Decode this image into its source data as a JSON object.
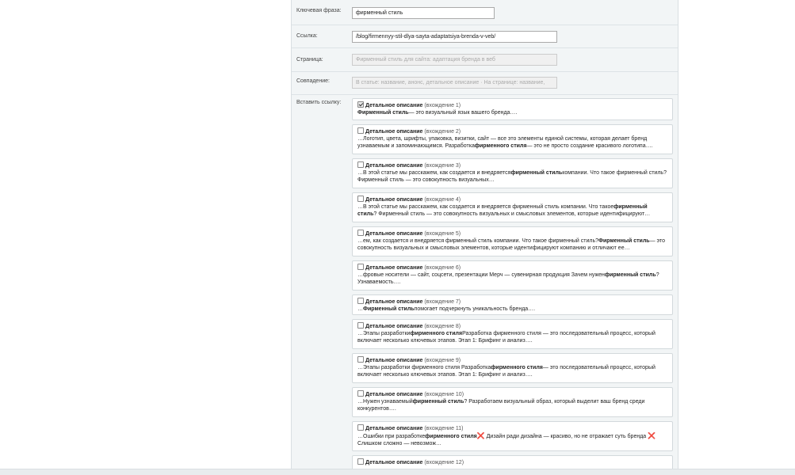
{
  "form": {
    "keyword_label": "Ключевая фраза:",
    "keyword_value": "фирменный стиль",
    "url_label": "Ссылка:",
    "url_value": "/blog/firmennyy-stil-dlya-sayta-adaptatsiya-brenda-v-veb/",
    "page_label": "Страница:",
    "page_value": "Фирменный стиль для сайта: адаптация бренда в веб",
    "match_label": "Совпадение:",
    "match_value": "В статье: название, анонс, детальное описание · На странице: название,",
    "insert_label": "Вставить ссылку:"
  },
  "occurrences": [
    {
      "title": "Детальное описание",
      "num": "(вхождение 1)",
      "checked": true,
      "body": [
        {
          "t": "Фирменный стиль",
          "b": true
        },
        {
          "t": "— это визуальный язык вашего бренда…."
        }
      ]
    },
    {
      "title": "Детальное описание",
      "num": "(вхождение 2)",
      "checked": false,
      "body": [
        {
          "t": "…Логотип, цвета, шрифты, упаковка, визитки, сайт — все это элементы единой системы, которая делает бренд узнаваемым и запоминающимся. Разработка"
        },
        {
          "t": "фирменного стиля",
          "b": true
        },
        {
          "t": "— это не просто создание красивого логотипа…."
        }
      ]
    },
    {
      "title": "Детальное описание",
      "num": "(вхождение 3)",
      "checked": false,
      "body": [
        {
          "t": "…В этой статье мы расскажем, как создается и внедряется"
        },
        {
          "t": "фирменный стиль",
          "b": true
        },
        {
          "t": "компании. Что такое фирменный стиль? Фирменный стиль — это совокупность визуальных…"
        }
      ]
    },
    {
      "title": "Детальное описание",
      "num": "(вхождение 4)",
      "checked": false,
      "body": [
        {
          "t": "…В этой статье мы расскажем, как создается и внедряется фирменный стиль компании. Что такое"
        },
        {
          "t": "фирменный стиль",
          "b": true
        },
        {
          "t": "? Фирменный стиль — это совокупность визуальных и смысловых элементов, которые идентифицируют…"
        }
      ]
    },
    {
      "title": "Детальное описание",
      "num": "(вхождение 5)",
      "checked": false,
      "body": [
        {
          "t": "…ем, как создается и внедряется фирменный стиль компании. Что такое фирменный стиль?"
        },
        {
          "t": "Фирменный стиль",
          "b": true
        },
        {
          "t": "— это совокупность визуальных и смысловых элементов, которые идентифицируют компанию и отличают ее…"
        }
      ]
    },
    {
      "title": "Детальное описание",
      "num": "(вхождение 6)",
      "checked": false,
      "body": [
        {
          "t": "…фровые носители — сайт, соцсети, презентации Мерч — сувенирная продукция Зачем нужен"
        },
        {
          "t": "фирменный стиль",
          "b": true
        },
        {
          "t": "? Узнаваемость…."
        }
      ]
    },
    {
      "title": "Детальное описание",
      "num": "(вхождение 7)",
      "checked": false,
      "body": [
        {
          "t": "…"
        },
        {
          "t": "Фирменный стиль",
          "b": true
        },
        {
          "t": "помогает подчеркнуть уникальность бренда…."
        }
      ]
    },
    {
      "title": "Детальное описание",
      "num": "(вхождение 8)",
      "checked": false,
      "body": [
        {
          "t": "…Этапы разработки"
        },
        {
          "t": "фирменного стиля",
          "b": true
        },
        {
          "t": "Разработка фирменного стиля — это последовательный процесс, который включает несколько ключевых этапов. Этап 1: Брифинг и анализ…."
        }
      ]
    },
    {
      "title": "Детальное описание",
      "num": "(вхождение 9)",
      "checked": false,
      "body": [
        {
          "t": "…Этапы разработки фирменного стиля Разработка"
        },
        {
          "t": "фирменного стиля",
          "b": true
        },
        {
          "t": "— это последовательный процесс, который включает несколько ключевых этапов. Этап 1: Брифинг и анализ…."
        }
      ]
    },
    {
      "title": "Детальное описание",
      "num": "(вхождение 10)",
      "checked": false,
      "body": [
        {
          "t": "…Нужен узнаваемый"
        },
        {
          "t": "фирменный стиль",
          "b": true
        },
        {
          "t": "? Разработаем визуальный образ, который выделит ваш бренд среди конкурентов…."
        }
      ]
    },
    {
      "title": "Детальное описание",
      "num": "(вхождение 11)",
      "checked": false,
      "body": [
        {
          "t": "…Ошибки при разработке"
        },
        {
          "t": "фирменного стиля",
          "b": true
        },
        {
          "t": "❌",
          "x": true
        },
        {
          "t": " Дизайн ради дизайна — красиво, но не отражает суть бренда "
        },
        {
          "t": "❌",
          "x": true
        },
        {
          "t": " Слишком сложно — невозмож…"
        }
      ]
    },
    {
      "title": "Детальное описание",
      "num": "(вхождение 12)",
      "checked": false,
      "body": []
    }
  ]
}
